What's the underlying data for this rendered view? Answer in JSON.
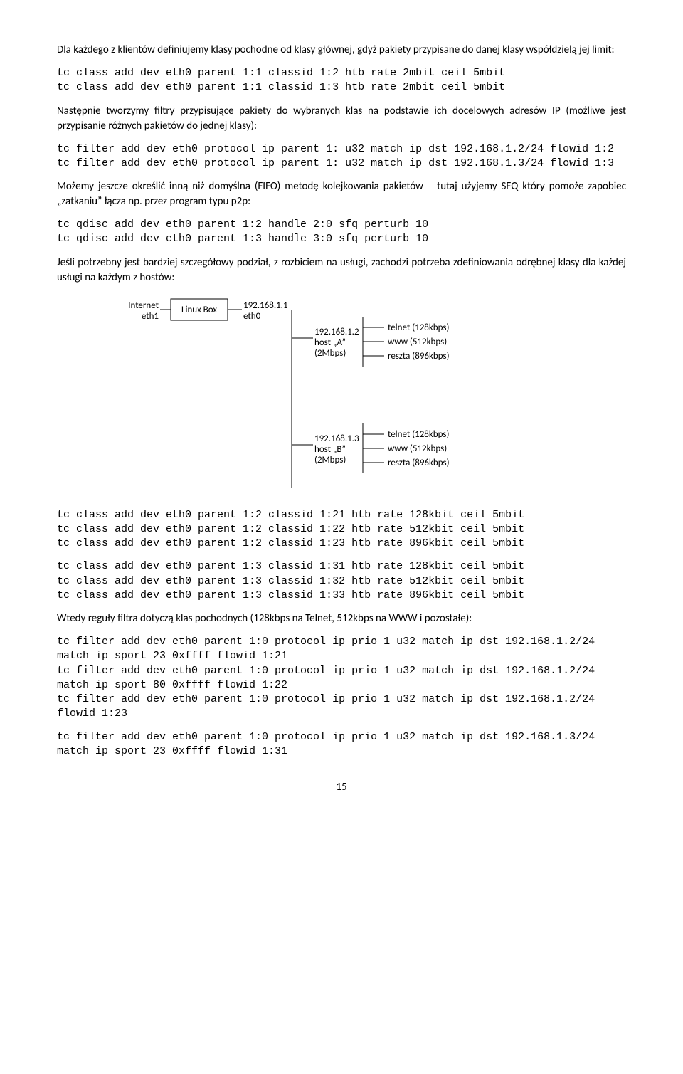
{
  "para1": "Dla każdego z klientów definiujemy klasy pochodne od klasy głównej, gdyż pakiety przypisane do danej klasy współdzielą jej limit:",
  "code1": "tc class add dev eth0 parent 1:1 classid 1:2 htb rate 2mbit ceil 5mbit\ntc class add dev eth0 parent 1:1 classid 1:3 htb rate 2mbit ceil 5mbit",
  "para2": "Następnie tworzymy filtry przypisujące pakiety do wybranych klas na podstawie ich docelowych adresów IP (możliwe jest przypisanie różnych pakietów do jednej klasy):",
  "code2": "tc filter add dev eth0 protocol ip parent 1: u32 match ip dst 192.168.1.2/24 flowid 1:2\ntc filter add dev eth0 protocol ip parent 1: u32 match ip dst 192.168.1.3/24 flowid 1:3",
  "para3": "Możemy jeszcze określić inną niż domyślna (FIFO) metodę kolejkowania pakietów – tutaj użyjemy SFQ który pomoże zapobiec „zatkaniu” łącza np. przez program typu p2p:",
  "code3": "tc qdisc add dev eth0 parent 1:2 handle 2:0 sfq perturb 10\ntc qdisc add dev eth0 parent 1:3 handle 3:0 sfq perturb 10",
  "para4": "Jeśli potrzebny jest bardziej szczegółowy podział, z rozbiciem na usługi, zachodzi potrzeba zdefiniowania odrębnej klasy dla każdej usługi na każdym z hostów:",
  "diagram": {
    "internet": "Internet",
    "eth1": "eth1",
    "linuxbox": "Linux Box",
    "gateway_ip": "192.168.1.1",
    "eth0": "eth0",
    "hostA_ip": "192.168.1.2",
    "hostA_name": "host „A”",
    "hostA_bw": "(2Mbps)",
    "hostB_ip": "192.168.1.3",
    "hostB_name": "host „B”",
    "hostB_bw": "(2Mbps)",
    "svc_telnet": "telnet (128kbps)",
    "svc_www": "www (512kbps)",
    "svc_rest": "reszta (896kbps)"
  },
  "code4": "tc class add dev eth0 parent 1:2 classid 1:21 htb rate 128kbit ceil 5mbit\ntc class add dev eth0 parent 1:2 classid 1:22 htb rate 512kbit ceil 5mbit\ntc class add dev eth0 parent 1:2 classid 1:23 htb rate 896kbit ceil 5mbit",
  "code5": "tc class add dev eth0 parent 1:3 classid 1:31 htb rate 128kbit ceil 5mbit\ntc class add dev eth0 parent 1:3 classid 1:32 htb rate 512kbit ceil 5mbit\ntc class add dev eth0 parent 1:3 classid 1:33 htb rate 896kbit ceil 5mbit",
  "para5": "Wtedy reguły filtra dotyczą klas pochodnych (128kbps na Telnet, 512kbps na WWW i pozostałe):",
  "code6": "tc filter add dev eth0 parent 1:0 protocol ip prio 1 u32 match ip dst 192.168.1.2/24 match ip sport 23 0xffff flowid 1:21\ntc filter add dev eth0 parent 1:0 protocol ip prio 1 u32 match ip dst 192.168.1.2/24 match ip sport 80 0xffff flowid 1:22\ntc filter add dev eth0 parent 1:0 protocol ip prio 1 u32 match ip dst 192.168.1.2/24 flowid 1:23",
  "code7": "tc filter add dev eth0 parent 1:0 protocol ip prio 1 u32 match ip dst 192.168.1.3/24 match ip sport 23 0xffff flowid 1:31",
  "page_number": "15"
}
